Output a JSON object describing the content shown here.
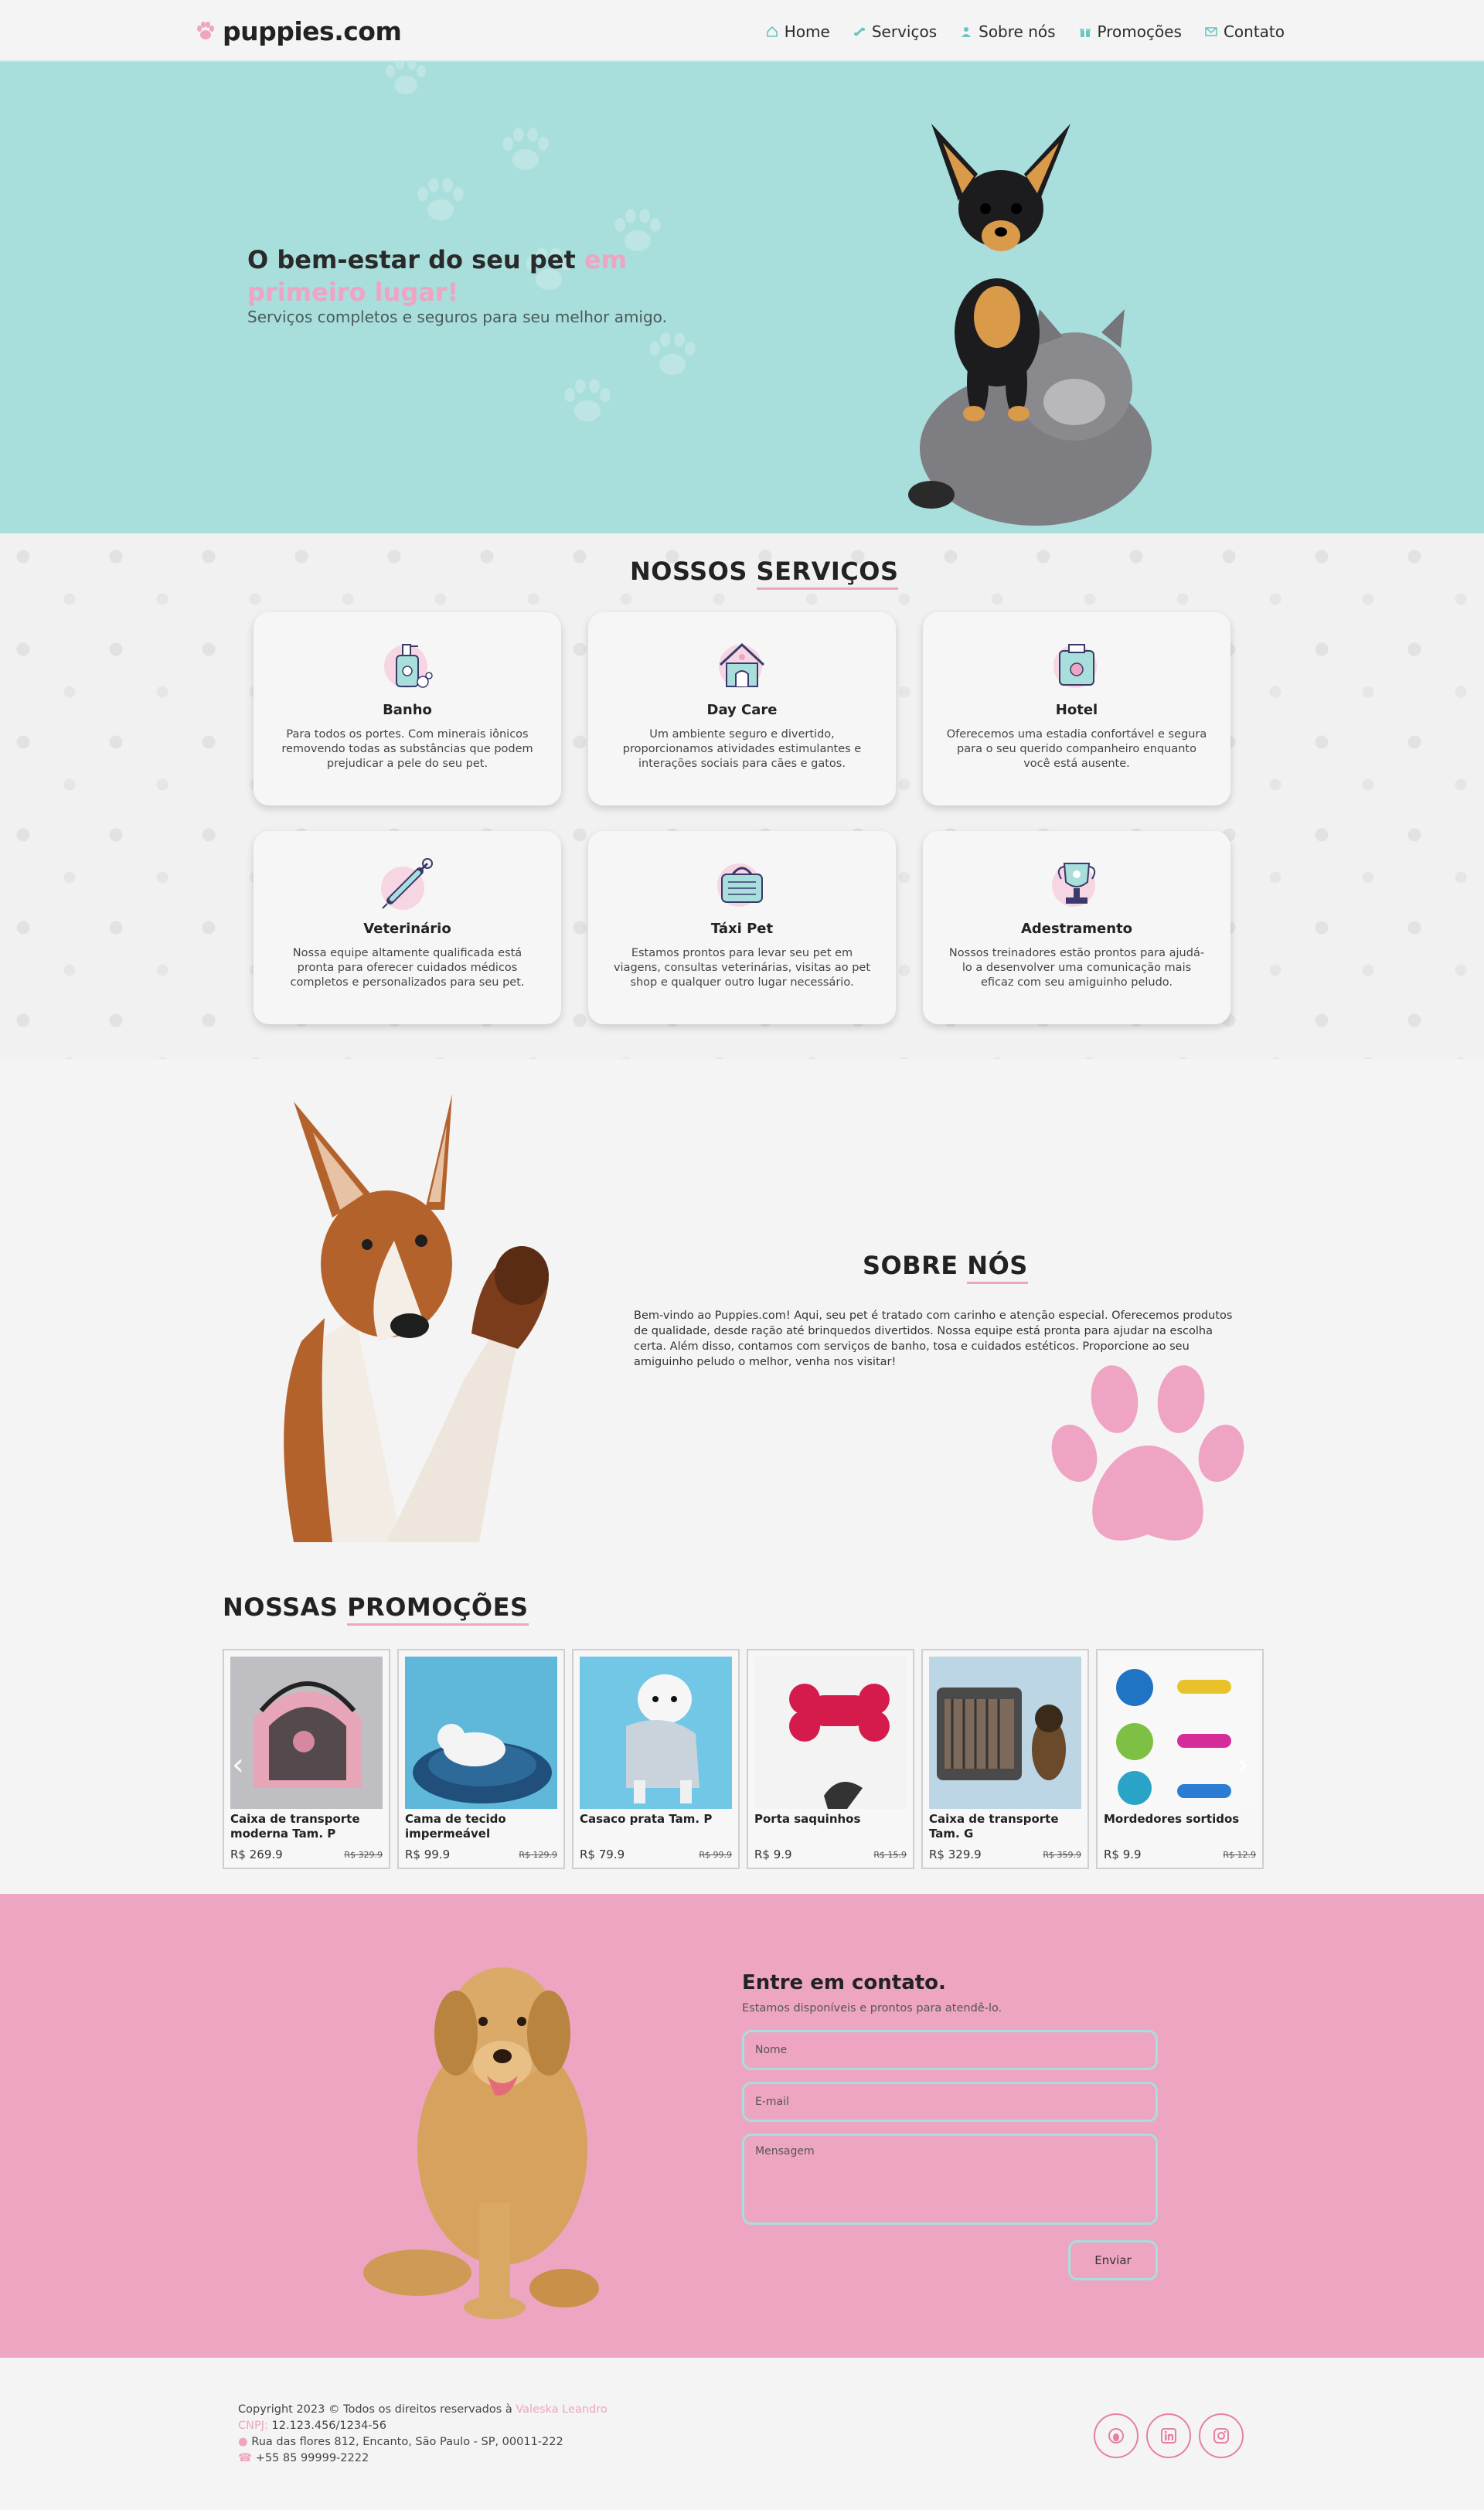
{
  "nav": {
    "brand": "puppies.com",
    "links": [
      {
        "label": "Home",
        "icon": "home-icon"
      },
      {
        "label": "Serviços",
        "icon": "bone-icon"
      },
      {
        "label": "Sobre nós",
        "icon": "user-icon"
      },
      {
        "label": "Promoções",
        "icon": "gift-icon"
      },
      {
        "label": "Contato",
        "icon": "mail-icon"
      }
    ]
  },
  "hero": {
    "title_main": "O bem-estar do seu pet ",
    "title_accent": "em primeiro lugar!",
    "subtitle": "Serviços completos e seguros para seu melhor amigo."
  },
  "services": {
    "title_a": "NOSSOS ",
    "title_b": "SERVIÇOS",
    "items": [
      {
        "title": "Banho",
        "desc": "Para todos os portes. Com minerais iônicos removendo todas as substâncias que podem prejudicar a pele do seu pet.",
        "icon": "shampoo-icon"
      },
      {
        "title": "Day Care",
        "desc": "Um ambiente seguro e divertido, proporcionamos atividades estimulantes e interações sociais para cães e gatos.",
        "icon": "pet-house-icon"
      },
      {
        "title": "Hotel",
        "desc": "Oferecemos uma estadia confortável e segura para o seu querido companheiro enquanto você está ausente.",
        "icon": "pet-hotel-icon"
      },
      {
        "title": "Veterinário",
        "desc": "Nossa equipe altamente qualificada está pronta para oferecer cuidados médicos completos e personalizados para seu pet.",
        "icon": "syringe-icon"
      },
      {
        "title": "Táxi Pet",
        "desc": "Estamos prontos para levar seu pet em viagens, consultas veterinárias, visitas ao pet shop e qualquer outro lugar necessário.",
        "icon": "pet-carrier-icon"
      },
      {
        "title": "Adestramento",
        "desc": "Nossos treinadores estão prontos para ajudá-lo a desenvolver uma comunicação mais eficaz com seu amiguinho peludo.",
        "icon": "trophy-icon"
      }
    ]
  },
  "about": {
    "title_a": "SOBRE ",
    "title_b": "NÓS",
    "text": "Bem-vindo ao Puppies.com! Aqui, seu pet é tratado com carinho e atenção especial. Oferecemos produtos de qualidade, desde ração até brinquedos divertidos. Nossa equipe está pronta para ajudar na escolha certa. Além disso, contamos com serviços de banho, tosa e cuidados estéticos. Proporcione ao seu amiguinho peludo o melhor, venha nos visitar!"
  },
  "promos": {
    "title_a": "NOSSAS ",
    "title_b": "PROMOÇÕES",
    "items": [
      {
        "name": "Caixa de transporte moderna Tam. P",
        "price": "R$ 269.9",
        "old": "R$ 329.9"
      },
      {
        "name": "Cama de tecido impermeável",
        "price": "R$ 99.9",
        "old": "R$ 129.9"
      },
      {
        "name": "Casaco prata Tam. P",
        "price": "R$ 79.9",
        "old": "R$ 99.9"
      },
      {
        "name": "Porta saquinhos",
        "price": "R$ 9.9",
        "old": "R$ 15.9"
      },
      {
        "name": "Caixa de transporte Tam. G",
        "price": "R$ 329.9",
        "old": "R$ 359.9"
      },
      {
        "name": "Mordedores sortidos",
        "price": "R$ 9.9",
        "old": "R$ 12.9"
      }
    ]
  },
  "contact": {
    "title": "Entre em contato.",
    "subtitle": "Estamos disponíveis e prontos para atendê-lo.",
    "name_placeholder": "Nome",
    "email_placeholder": "E-mail",
    "message_placeholder": "Mensagem",
    "send_label": "Enviar"
  },
  "footer": {
    "copyright": "Copyright 2023 © Todos os direitos reservados à ",
    "author": "Valeska Leandro",
    "cnpj_label": "CNPJ: ",
    "cnpj": "12.123.456/1234-56",
    "address": "Rua das flores 812, Encanto, São Paulo - SP, 00011-222",
    "phone": "+55 85 99999-2222",
    "social": [
      "github-icon",
      "linkedin-icon",
      "instagram-icon"
    ]
  },
  "colors": {
    "teal": "#a8dedc",
    "pink": "#eda5c2",
    "background": "#f4f4f4"
  }
}
